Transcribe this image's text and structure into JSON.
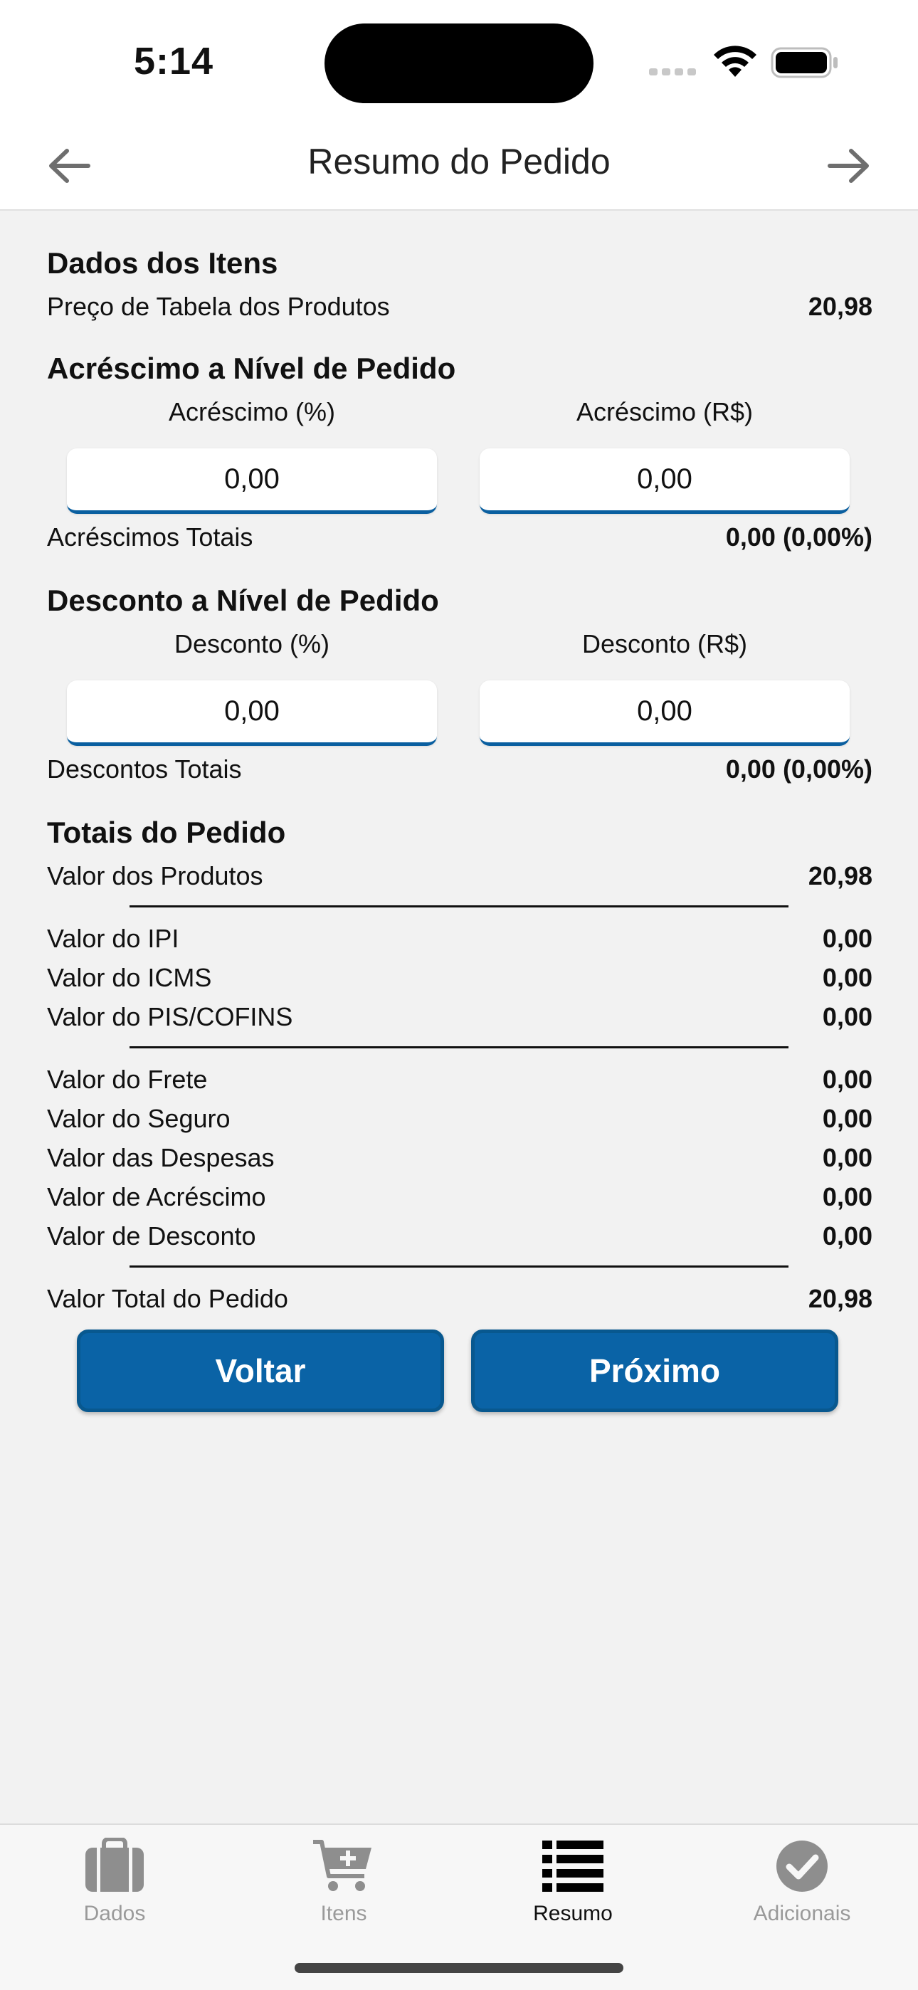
{
  "status_bar": {
    "time": "5:14"
  },
  "nav": {
    "title": "Resumo do Pedido"
  },
  "items": {
    "title": "Dados dos Itens",
    "table_price_label": "Preço de Tabela dos Produtos",
    "table_price_value": "20,98"
  },
  "increase": {
    "title": "Acréscimo a Nível de Pedido",
    "percent_label": "Acréscimo (%)",
    "amount_label": "Acréscimo (R$)",
    "percent_value": "0,00",
    "amount_value": "0,00",
    "total_label": "Acréscimos Totais",
    "total_value": "0,00 (0,00%)"
  },
  "discount": {
    "title": "Desconto a Nível de Pedido",
    "percent_label": "Desconto (%)",
    "amount_label": "Desconto (R$)",
    "percent_value": "0,00",
    "amount_value": "0,00",
    "total_label": "Descontos Totais",
    "total_value": "0,00 (0,00%)"
  },
  "totals": {
    "title": "Totais do Pedido",
    "rows": [
      {
        "label": "Valor dos Produtos",
        "value": "20,98"
      },
      {
        "label": "Valor do IPI",
        "value": "0,00"
      },
      {
        "label": "Valor do ICMS",
        "value": "0,00"
      },
      {
        "label": "Valor do PIS/COFINS",
        "value": "0,00"
      },
      {
        "label": "Valor do Frete",
        "value": "0,00"
      },
      {
        "label": "Valor do Seguro",
        "value": "0,00"
      },
      {
        "label": "Valor das Despesas",
        "value": "0,00"
      },
      {
        "label": "Valor de Acréscimo",
        "value": "0,00"
      },
      {
        "label": "Valor de Desconto",
        "value": "0,00"
      },
      {
        "label": "Valor Total do Pedido",
        "value": "20,98"
      }
    ]
  },
  "buttons": {
    "back": "Voltar",
    "next": "Próximo"
  },
  "tabs": [
    {
      "label": "Dados",
      "icon": "briefcase-icon"
    },
    {
      "label": "Itens",
      "icon": "cart-plus-icon"
    },
    {
      "label": "Resumo",
      "icon": "list-icon",
      "active": true
    },
    {
      "label": "Adicionais",
      "icon": "check-circle-icon"
    }
  ],
  "colors": {
    "accent": "#0a63a6",
    "field_underline": "#0a5fa0",
    "tab_inactive": "#9a9a9a",
    "tab_active": "#111111"
  }
}
